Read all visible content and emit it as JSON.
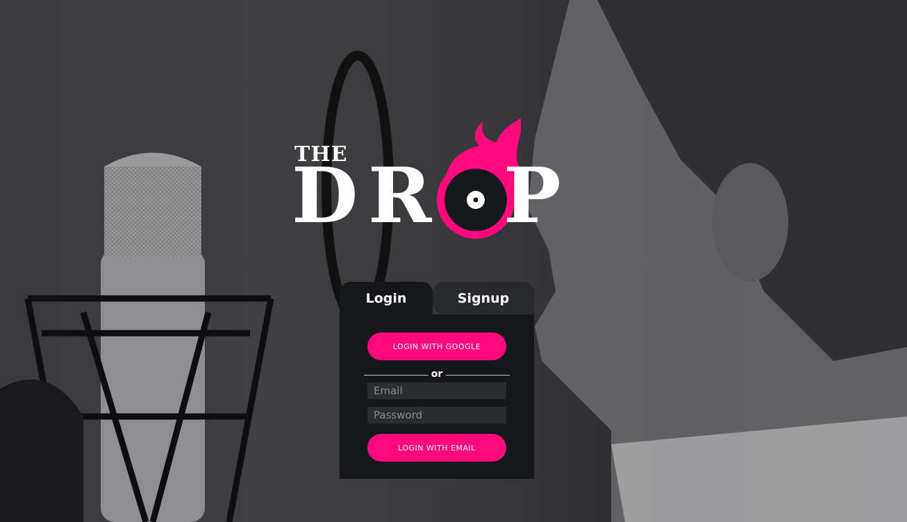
{
  "logo": {
    "the": "THE",
    "letters": [
      "D",
      "R",
      "P"
    ]
  },
  "tabs": [
    {
      "label": "Login",
      "active": true
    },
    {
      "label": "Signup",
      "active": false
    }
  ],
  "form": {
    "google_button": "LOGIN WITH GOOGLE",
    "divider": "or",
    "email_placeholder": "Email",
    "password_placeholder": "Password",
    "email_button": "LOGIN WITH EMAIL"
  },
  "colors": {
    "accent": "#ff0a7d",
    "card": "#16171b",
    "inactive_tab": "#27292d"
  }
}
